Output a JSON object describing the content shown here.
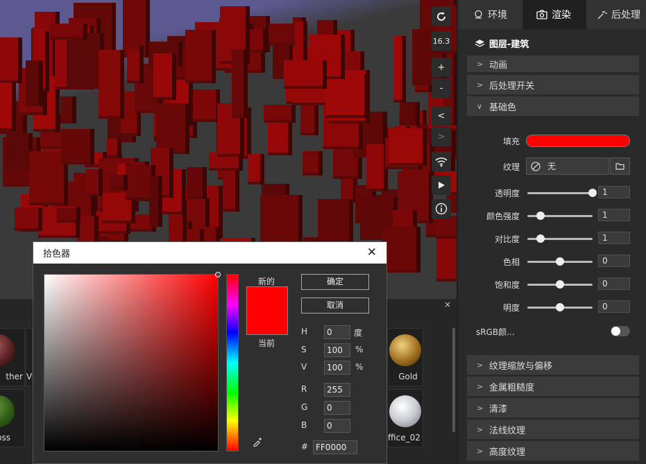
{
  "toolbar": {
    "refresh_icon": "refresh-icon",
    "level": "16.3",
    "zoom_in": "+",
    "zoom_out": "-",
    "prev": "<",
    "next": ">",
    "wifi_icon": "wifi-icon",
    "play_icon": "play-icon",
    "info_icon": "info-icon"
  },
  "library": {
    "close": "×",
    "items": [
      "ther",
      "V",
      "Gold",
      "oss",
      "ffice_02"
    ]
  },
  "picker": {
    "title": "拾色器",
    "close": "✕",
    "new_label": "新的",
    "current_label": "当前",
    "ok": "确定",
    "cancel": "取消",
    "h_label": "H",
    "h": "0",
    "h_unit": "度",
    "s_label": "S",
    "s": "100",
    "s_unit": "%",
    "v_label": "V",
    "v": "100",
    "v_unit": "%",
    "r_label": "R",
    "r": "255",
    "g_label": "G",
    "g": "0",
    "b_label": "B",
    "b": "0",
    "hex_label": "#",
    "hex": "FF0000",
    "color": "#ff0000"
  },
  "panel": {
    "tabs": [
      {
        "label": "环境"
      },
      {
        "label": "渲染"
      },
      {
        "label": "后处理"
      }
    ],
    "layer_title": "图层-建筑",
    "sections_top": [
      "动画",
      "后处理开关",
      "基础色"
    ],
    "fill_label": "填充",
    "fill_color": "#ff0000",
    "texture_label": "纹理",
    "texture_value": "无",
    "sliders": [
      {
        "label": "透明度",
        "value": "1",
        "level": 1.0
      },
      {
        "label": "颜色强度",
        "value": "1",
        "level": 0.2
      },
      {
        "label": "对比度",
        "value": "1",
        "level": 0.2
      },
      {
        "label": "色相",
        "value": "0",
        "level": 0.5
      },
      {
        "label": "饱和度",
        "value": "0",
        "level": 0.5
      },
      {
        "label": "明度",
        "value": "0",
        "level": 0.5
      }
    ],
    "srgb_label": "sRGB颜...",
    "sections_bottom": [
      "纹理缩放与偏移",
      "金属粗糙度",
      "清漆",
      "法线纹理",
      "高度纹理"
    ]
  }
}
